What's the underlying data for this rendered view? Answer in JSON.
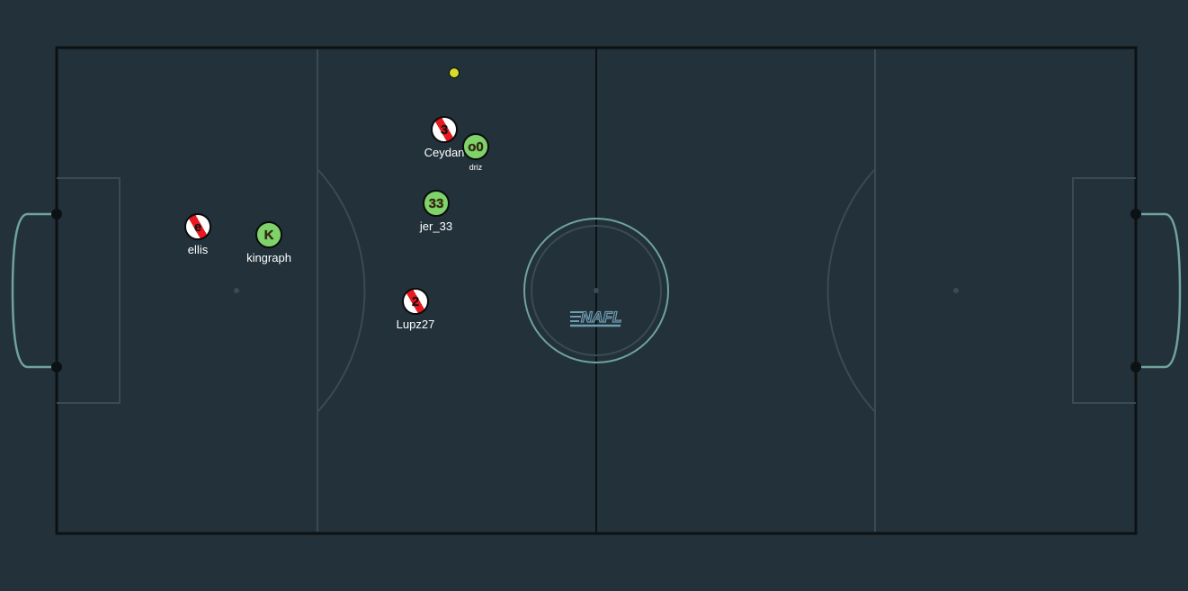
{
  "colors": {
    "background": "#22313a",
    "field_lines": "#0c1114",
    "field_markings": "#3a4b55",
    "goal": "#6fa39b",
    "red_team": "#e8191f",
    "green_team": "#7ed46a",
    "ball": "#d7dc2c"
  },
  "logo": {
    "text": "NAFL"
  },
  "players": [
    {
      "id": "ceydan",
      "team": "red",
      "avatar": "3",
      "nick": "Ceydan"
    },
    {
      "id": "driz",
      "team": "green",
      "avatar": "o0",
      "nick": "driz"
    },
    {
      "id": "jer_33",
      "team": "green",
      "avatar": "33",
      "nick": "jer_33"
    },
    {
      "id": "ellis",
      "team": "red",
      "avatar": "e",
      "nick": "ellis"
    },
    {
      "id": "kingraph",
      "team": "green",
      "avatar": "K",
      "nick": "kingraph"
    },
    {
      "id": "lupz27",
      "team": "red",
      "avatar": "2",
      "nick": "Lupz27"
    }
  ],
  "ball": {
    "color": "#d7dc2c"
  }
}
